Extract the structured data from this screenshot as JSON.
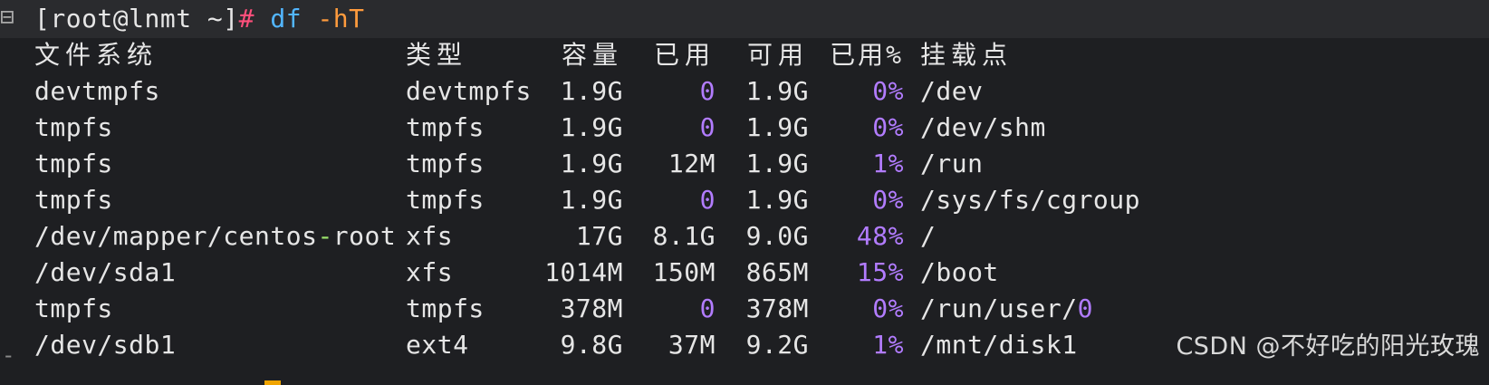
{
  "prompt": {
    "user_host_dir": "[root@lnmt ~]",
    "symbol": "#",
    "command": "df",
    "args": "-hT"
  },
  "table": {
    "headers": {
      "filesystem": "文件系统",
      "type": "类型",
      "size": "容量",
      "used": "已用",
      "avail": "可用",
      "use_pct": "已用%",
      "mount": "挂载点"
    },
    "rows": [
      {
        "fs": "devtmpfs",
        "type": "devtmpfs",
        "size": "1.9G",
        "used": "0",
        "avail": "1.9G",
        "pct": "0%",
        "mount": "/dev"
      },
      {
        "fs": "tmpfs",
        "type": "tmpfs",
        "size": "1.9G",
        "used": "0",
        "avail": "1.9G",
        "pct": "0%",
        "mount": "/dev/shm"
      },
      {
        "fs": "tmpfs",
        "type": "tmpfs",
        "size": "1.9G",
        "used": "12M",
        "avail": "1.9G",
        "pct": "1%",
        "mount": "/run"
      },
      {
        "fs": "tmpfs",
        "type": "tmpfs",
        "size": "1.9G",
        "used": "0",
        "avail": "1.9G",
        "pct": "0%",
        "mount": "/sys/fs/cgroup"
      },
      {
        "fs_a": "/dev/mapper/centos",
        "fs_dash": "-",
        "fs_b": "root",
        "type": "xfs",
        "size": "17G",
        "used": "8.1G",
        "avail": "9.0G",
        "pct": "48%",
        "mount": "/"
      },
      {
        "fs": "/dev/sda1",
        "type": "xfs",
        "size": "1014M",
        "used": "150M",
        "avail": "865M",
        "pct": "15%",
        "mount": "/boot"
      },
      {
        "fs": "tmpfs",
        "type": "tmpfs",
        "size": "378M",
        "used": "0",
        "avail": "378M",
        "pct": "0%",
        "mount_a": "/run/user/",
        "mount_b": "0"
      },
      {
        "fs": "/dev/sdb1",
        "type": "ext4",
        "size": "9.8G",
        "used": "37M",
        "avail": "9.2G",
        "pct": "1%",
        "mount": "/mnt/disk1"
      }
    ]
  },
  "watermark": "CSDN @不好吃的阳光玫瑰",
  "colors": {
    "background": "#1e1f22",
    "prompt_hash": "#ff4f7b",
    "command": "#52b6ff",
    "flag": "#ff9b3d",
    "numeric_highlight": "#b27cff",
    "cursor": "#f0a400"
  }
}
